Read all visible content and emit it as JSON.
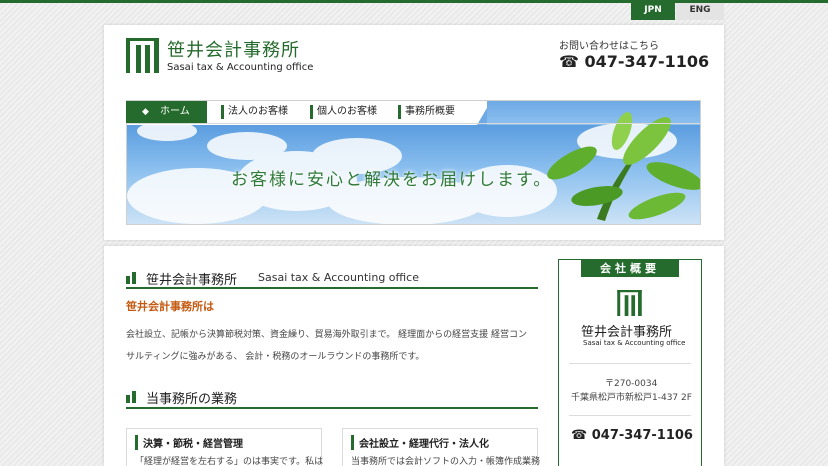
{
  "lang": {
    "jpn": "JPN",
    "eng": "ENG"
  },
  "brand": {
    "name_jp": "笹井会計事務所",
    "name_en": "Sasai tax & Accounting office"
  },
  "contact": {
    "label": "お問い合わせはこちら",
    "phone": "047-347-1106"
  },
  "nav": {
    "home": "ホーム",
    "items": [
      "法人のお客様",
      "個人のお客様",
      "事務所概要"
    ]
  },
  "banner": {
    "tagline": "お客様に安心と解決をお届けします。"
  },
  "about": {
    "title_jp": "笹井会計事務所",
    "title_en": "Sasai tax & Accounting office",
    "heading": "笹井会計事務所は",
    "body_line1": "会社設立、記帳から決算節税対策、資金繰り、貿易海外取引まで。 経理面からの経営支援 経営コン",
    "body_line2": "サルティングに強みがある、 会計・税務のオールラウンドの事務所です。"
  },
  "business": {
    "title": "当事務所の業務",
    "cards": [
      {
        "title": "決算・節税・経営管理",
        "text": "「経理が経営を左右する」のは事実です。私は"
      },
      {
        "title": "会社設立・経理代行・法人化",
        "text": "当事務所では会計ソフトの入力・帳簿作成業務"
      }
    ]
  },
  "sidebar": {
    "tab": "会社概要",
    "name_jp": "笹井会計事務所",
    "name_en": "Sasai tax & Accounting office",
    "zip": "〒270-0034",
    "address": "千葉県松戸市新松戸1-437 2F",
    "phone": "047-347-1106"
  },
  "colors": {
    "brand_green": "#256b2d",
    "accent_orange": "#c45a12"
  },
  "icons": [
    "logo-mark",
    "phone-icon",
    "home-icon",
    "section-bar-icon"
  ]
}
